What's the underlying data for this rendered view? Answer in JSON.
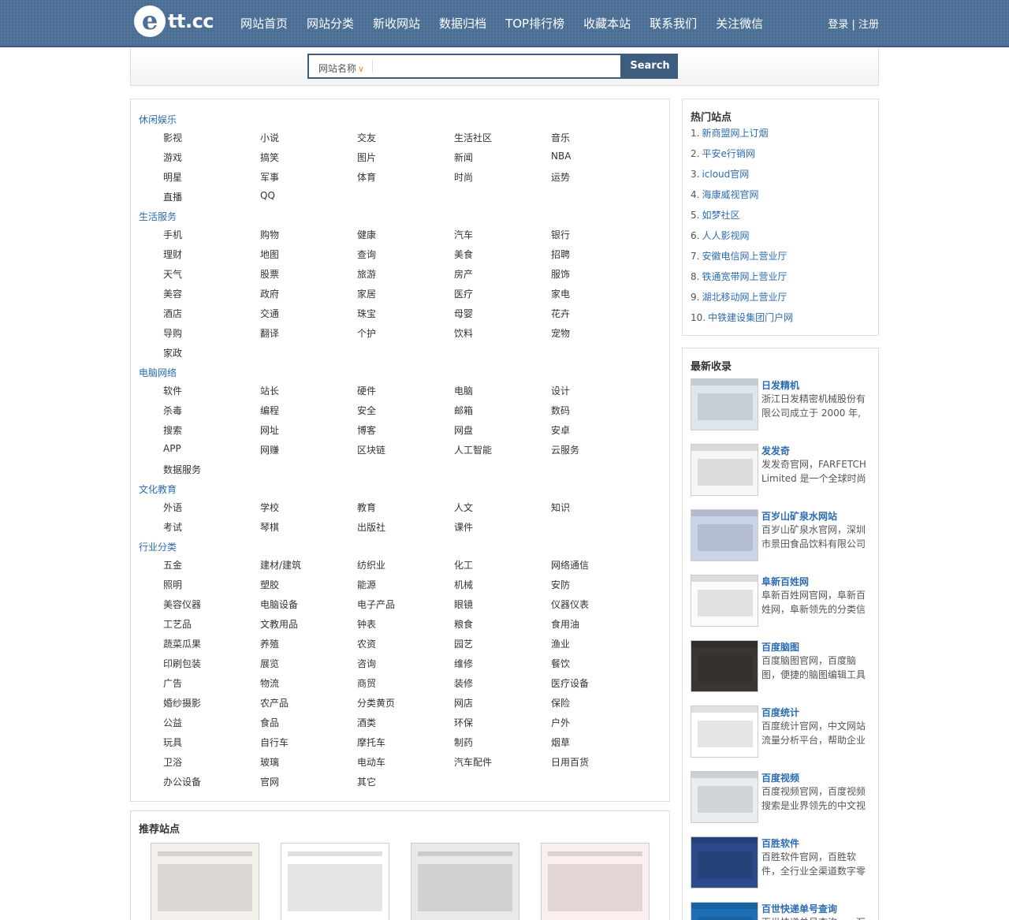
{
  "header": {
    "logo_mark": "e",
    "logo_text": "tt.cc",
    "nav": [
      "网站首页",
      "网站分类",
      "新收网站",
      "数据归档",
      "TOP排行榜",
      "收藏本站",
      "联系我们",
      "关注微信"
    ],
    "login": "登录 | 注册"
  },
  "search": {
    "type_label": "网站名称",
    "button": "Search"
  },
  "categories": [
    {
      "title": "休闲娱乐",
      "items": [
        "影视",
        "小说",
        "交友",
        "生活社区",
        "音乐",
        "游戏",
        "搞笑",
        "图片",
        "新闻",
        "NBA",
        "明星",
        "军事",
        "体育",
        "时尚",
        "运势",
        "直播",
        "QQ"
      ]
    },
    {
      "title": "生活服务",
      "items": [
        "手机",
        "购物",
        "健康",
        "汽车",
        "银行",
        "理财",
        "地图",
        "查询",
        "美食",
        "招聘",
        "天气",
        "股票",
        "旅游",
        "房产",
        "服饰",
        "美容",
        "政府",
        "家居",
        "医疗",
        "家电",
        "酒店",
        "交通",
        "珠宝",
        "母婴",
        "花卉",
        "导购",
        "翻译",
        "个护",
        "饮料",
        "宠物",
        "家政"
      ]
    },
    {
      "title": "电脑网络",
      "items": [
        "软件",
        "站长",
        "硬件",
        "电脑",
        "设计",
        "杀毒",
        "编程",
        "安全",
        "邮箱",
        "数码",
        "搜索",
        "网址",
        "博客",
        "网盘",
        "安卓",
        "APP",
        "网赚",
        "区块链",
        "人工智能",
        "云服务",
        "数据服务"
      ]
    },
    {
      "title": "文化教育",
      "items": [
        "外语",
        "学校",
        "教育",
        "人文",
        "知识",
        "考试",
        "琴棋",
        "出版社",
        "课件"
      ]
    },
    {
      "title": "行业分类",
      "items": [
        "五金",
        "建材/建筑",
        "纺织业",
        "化工",
        "网络通信",
        "照明",
        "塑胶",
        "能源",
        "机械",
        "安防",
        "美容仪器",
        "电脑设备",
        "电子产品",
        "眼镜",
        "仪器仪表",
        "工艺品",
        "文教用品",
        "钟表",
        "粮食",
        "食用油",
        "蔬菜瓜果",
        "养殖",
        "农资",
        "园艺",
        "渔业",
        "印刷包装",
        "展览",
        "咨询",
        "维修",
        "餐饮",
        "广告",
        "物流",
        "商贸",
        "装修",
        "医疗设备",
        "婚纱摄影",
        "农产品",
        "分类黄页",
        "网店",
        "保险",
        "公益",
        "食品",
        "酒类",
        "环保",
        "户外",
        "玩具",
        "自行车",
        "摩托车",
        "制药",
        "烟草",
        "卫浴",
        "玻璃",
        "电动车",
        "汽车配件",
        "日用百货",
        "办公设备",
        "官网",
        "其它"
      ]
    }
  ],
  "hot": {
    "title": "热门站点",
    "items": [
      {
        "num": "1.",
        "name": "新商盟网上订烟"
      },
      {
        "num": "2.",
        "name": "平安e行销网"
      },
      {
        "num": "3.",
        "name": "icloud官网"
      },
      {
        "num": "4.",
        "name": "海康威视官网"
      },
      {
        "num": "5.",
        "name": "如梦社区"
      },
      {
        "num": "6.",
        "name": "人人影视网"
      },
      {
        "num": "7.",
        "name": "安徽电信网上营业厅"
      },
      {
        "num": "8.",
        "name": "铁通宽带网上营业厅"
      },
      {
        "num": "9.",
        "name": "湖北移动网上营业厅"
      },
      {
        "num": "10.",
        "name": "中铁建设集团门户网"
      }
    ]
  },
  "latest": {
    "title": "最新收录",
    "items": [
      {
        "title": "日发精机",
        "desc": "浙江日发精密机械股份有限公司成立于 2000 年,",
        "thumb": "#dfe6ee"
      },
      {
        "title": "发发奇",
        "desc": "发发奇官网，FARFETCH Limited 是一个全球时尚",
        "thumb": "#f4f6f8"
      },
      {
        "title": "百岁山矿泉水网站",
        "desc": "百岁山矿泉水官网，深圳市景田食品饮料有限公司",
        "thumb": "#c9d3ea"
      },
      {
        "title": "阜新百姓网",
        "desc": "阜新百姓网官网，阜新百姓网，阜新领先的分类信",
        "thumb": "#fbfbfb"
      },
      {
        "title": "百度脑图",
        "desc": "百度脑图官网，百度脑图，便捷的脑图编辑工具",
        "thumb": "#3a3632"
      },
      {
        "title": "百度统计",
        "desc": "百度统计官网，中文网站流量分析平台，帮助企业",
        "thumb": "#ffffff"
      },
      {
        "title": "百度视频",
        "desc": "百度视频官网，百度视频搜索是业界领先的中文视",
        "thumb": "#e9ecf1"
      },
      {
        "title": "百胜软件",
        "desc": "百胜软件官网，百胜软件，全行业全渠道数字零",
        "thumb": "#2a4a8a"
      },
      {
        "title": "百世快递单号查询",
        "desc": "百世快递单号查询，一汇",
        "thumb": "#1d6fb5"
      }
    ]
  },
  "recommended": {
    "title": "推荐站点",
    "thumbs": [
      "#f4f1ec",
      "#ffffff",
      "#e9e9ea",
      "#fbeeee"
    ]
  },
  "colors": {
    "header_bg": "#4a6e94",
    "link_blue": "#2b6cb0",
    "search_btn": "#3d5c7e",
    "chevron": "#e08a1e"
  }
}
